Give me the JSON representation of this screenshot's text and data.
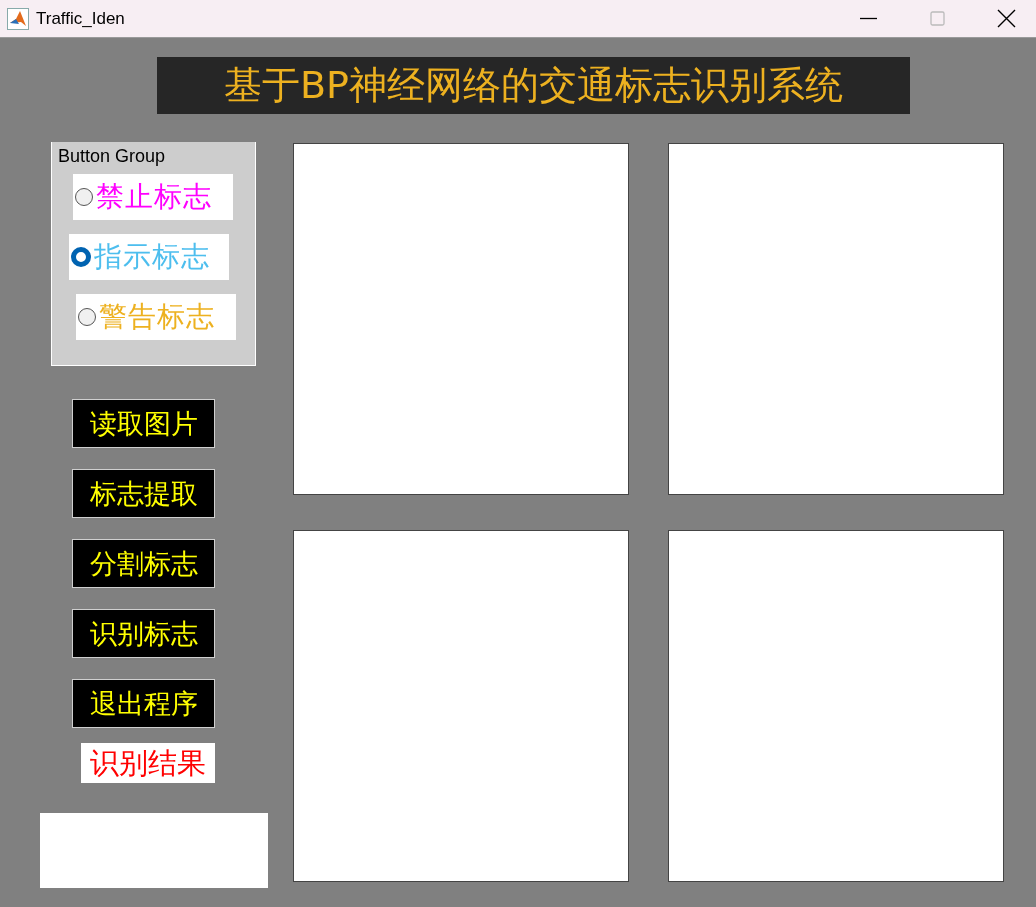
{
  "window": {
    "title": "Traffic_Iden"
  },
  "heading": "基于BP神经网络的交通标志识别系统",
  "button_group": {
    "title": "Button Group",
    "options": [
      {
        "label": "禁止标志",
        "selected": false,
        "color": "#ff00ff"
      },
      {
        "label": "指示标志",
        "selected": true,
        "color": "#4dbeee"
      },
      {
        "label": "警告标志",
        "selected": false,
        "color": "#edb120"
      }
    ]
  },
  "buttons": [
    "读取图片",
    "标志提取",
    "分割标志",
    "识别标志",
    "退出程序"
  ],
  "result_label": "识别结果"
}
